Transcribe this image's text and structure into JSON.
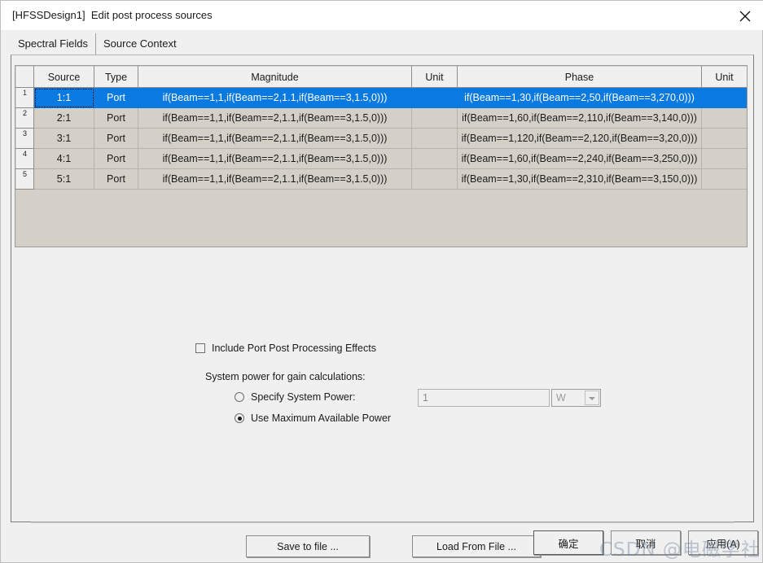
{
  "window": {
    "title": "[HFSSDesign1]  Edit post process sources",
    "close_icon": "close-icon"
  },
  "tabs": [
    {
      "label": "Spectral Fields",
      "active": true
    },
    {
      "label": "Source Context",
      "active": false
    }
  ],
  "grid": {
    "columns": [
      "",
      "Source",
      "Type",
      "Magnitude",
      "Unit",
      "Phase",
      "Unit"
    ],
    "rows": [
      {
        "num": "1",
        "source": "1:1",
        "type": "Port",
        "magnitude": "if(Beam==1,1,if(Beam==2,1.1,if(Beam==3,1.5,0)))",
        "unit1": "",
        "phase": "if(Beam==1,30,if(Beam==2,50,if(Beam==3,270,0)))",
        "unit2": "",
        "selected": true
      },
      {
        "num": "2",
        "source": "2:1",
        "type": "Port",
        "magnitude": "if(Beam==1,1,if(Beam==2,1.1,if(Beam==3,1.5,0)))",
        "unit1": "",
        "phase": "if(Beam==1,60,if(Beam==2,110,if(Beam==3,140,0)))",
        "unit2": "",
        "selected": false
      },
      {
        "num": "3",
        "source": "3:1",
        "type": "Port",
        "magnitude": "if(Beam==1,1,if(Beam==2,1.1,if(Beam==3,1.5,0)))",
        "unit1": "",
        "phase": "if(Beam==1,120,if(Beam==2,120,if(Beam==3,20,0)))",
        "unit2": "",
        "selected": false
      },
      {
        "num": "4",
        "source": "4:1",
        "type": "Port",
        "magnitude": "if(Beam==1,1,if(Beam==2,1.1,if(Beam==3,1.5,0)))",
        "unit1": "",
        "phase": "if(Beam==1,60,if(Beam==2,240,if(Beam==3,250,0)))",
        "unit2": "",
        "selected": false
      },
      {
        "num": "5",
        "source": "5:1",
        "type": "Port",
        "magnitude": "if(Beam==1,1,if(Beam==2,1.1,if(Beam==3,1.5,0)))",
        "unit1": "",
        "phase": "if(Beam==1,30,if(Beam==2,310,if(Beam==3,150,0)))",
        "unit2": "",
        "selected": false
      }
    ]
  },
  "options": {
    "include_port_effects": {
      "label": "Include Port Post Processing Effects",
      "checked": false
    },
    "system_power_label": "System power for gain calculations:",
    "specify_system_power": {
      "label": "Specify System Power:",
      "checked": false
    },
    "use_maximum_available_power": {
      "label": "Use Maximum Available Power",
      "checked": true
    },
    "power_value": "1",
    "power_unit": "W"
  },
  "file_buttons": {
    "save": "Save to file ...",
    "load": "Load From File ..."
  },
  "actions": {
    "ok": "确定",
    "cancel": "取消",
    "apply": "应用(A)"
  },
  "watermark": "CSDN @电磁学社",
  "colors": {
    "selection_blue": "#0a7ae0",
    "grid_body": "#d4d0c8",
    "dialog_bg": "#f0f0f0"
  }
}
